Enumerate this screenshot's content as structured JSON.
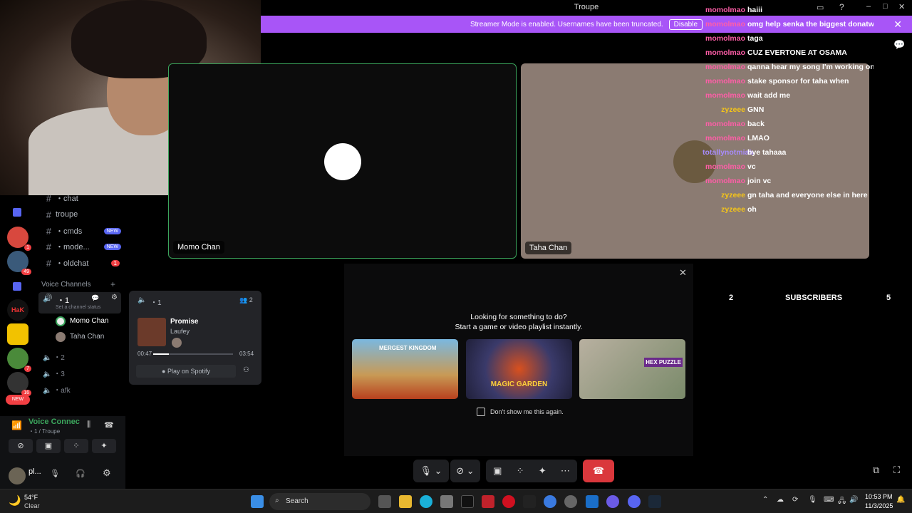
{
  "window": {
    "title": "Troupe"
  },
  "banner": {
    "text": "Streamer Mode is enabled. Usernames have been truncated.",
    "button": "Disable"
  },
  "channels": {
    "items": [
      {
        "name": "・chat",
        "badge": ""
      },
      {
        "name": "troupe",
        "badge": ""
      },
      {
        "name": "・cmds",
        "badge": "NEW"
      },
      {
        "name": "・mode...",
        "badge": "NEW"
      },
      {
        "name": "・oldchat",
        "badge": "1"
      }
    ],
    "voice_header": "Voice Channels",
    "voice_channel_1": "・1",
    "status_placeholder": "Set a channel status",
    "members": [
      "Momo Chan",
      "Taha Chan"
    ],
    "voice_channel_2": "・2",
    "voice_channel_3": "・3",
    "voice_channel_afk": "・afk"
  },
  "voice": {
    "status": "Voice Connected",
    "location": "・1 / Troupe"
  },
  "user": {
    "name": "pl..."
  },
  "spotify": {
    "channel": "・1",
    "listeners": "2",
    "song": "Promise",
    "artist": "Laufey",
    "elapsed": "00:47",
    "duration": "03:54",
    "progress_percent": 20,
    "play_label": "Play on Spotify"
  },
  "tiles": {
    "left": "Momo Chan",
    "right": "Taha Chan"
  },
  "chat": [
    {
      "user": "momolmao",
      "text": "haiii",
      "color": "pink"
    },
    {
      "user": "momolmao",
      "text": "omg help senka the biggest donatwe",
      "color": "pink"
    },
    {
      "user": "momolmao",
      "text": "taga",
      "color": "pink"
    },
    {
      "user": "momolmao",
      "text": "CUZ EVERTONE AT OSAMA",
      "color": "pink"
    },
    {
      "user": "momolmao",
      "text": "qanna hear my song I'm working on",
      "color": "pink"
    },
    {
      "user": "momolmao",
      "text": "stake sponsor for taha when",
      "color": "pink"
    },
    {
      "user": "momolmao",
      "text": "wait add me",
      "color": "pink"
    },
    {
      "user": "zyzeee",
      "text": "GNN",
      "color": "yellow"
    },
    {
      "user": "momolmao",
      "text": "back",
      "color": "pink"
    },
    {
      "user": "momolmao",
      "text": "LMAO",
      "color": "pink"
    },
    {
      "user": "totallynotmiab",
      "text": "bye tahaaa",
      "color": "purple"
    },
    {
      "user": "momolmao",
      "text": "vc",
      "color": "pink"
    },
    {
      "user": "momolmao",
      "text": "join vc",
      "color": "pink"
    },
    {
      "user": "zyzeee",
      "text": "gn taha and everyone else in here",
      "color": "yellow"
    },
    {
      "user": "zyzeee",
      "text": "oh",
      "color": "yellow"
    }
  ],
  "activity": {
    "line1": "Looking for something to do?",
    "line2": "Start a game or video playlist instantly.",
    "checkbox": "Don't show me this again.",
    "games": [
      "MERGEST KINGDOM",
      "MAGIC GARDEN",
      "HEX PUZZLE"
    ]
  },
  "subs": {
    "left_num": "2",
    "label": "SUBSCRIBERS",
    "right_num": "5"
  },
  "taskbar": {
    "weather_temp": "54°F",
    "weather_text": "Clear",
    "search": "Search",
    "time": "10:53 PM",
    "date": "11/3/2025"
  },
  "colors": {
    "banner": "#a855f7",
    "speaking": "#3ba55c",
    "hangup": "#da373c",
    "chat_pink": "#ff5ea8",
    "chat_yellow": "#f5c518"
  }
}
